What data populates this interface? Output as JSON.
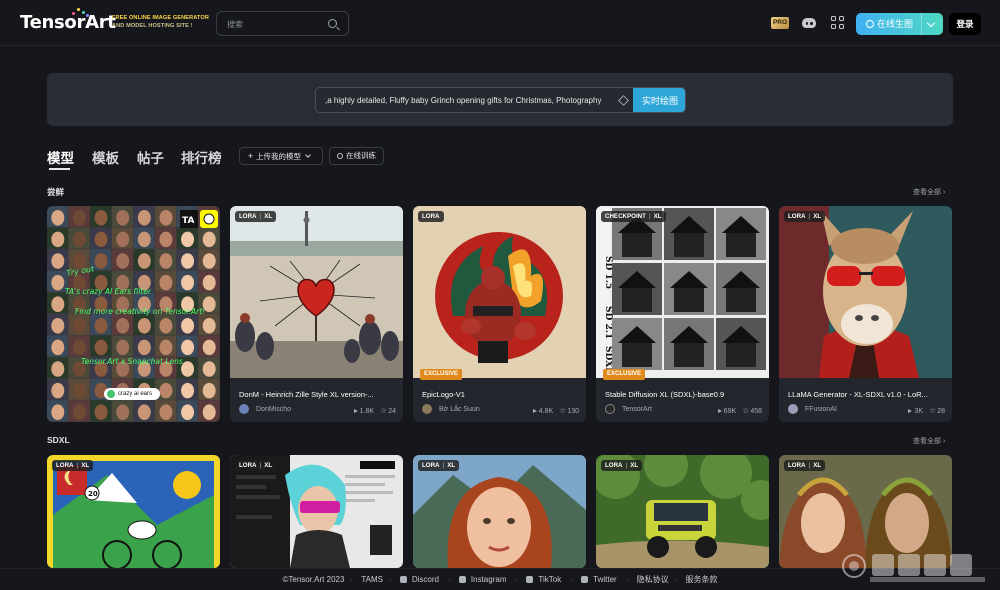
{
  "header": {
    "logo_text": "TensorArt",
    "tagline_line1": "FREE ONLINE IMAGE GENERATOR",
    "tagline_line2": "AND MODEL HOSTING SITE !",
    "search_placeholder": "搜索",
    "pro_label": "PRO",
    "create_button_label": "在线生图",
    "login_label": "登录"
  },
  "banner": {
    "prompt_text": ",a highly detailed, Fluffy baby Grinch opening gifts for Christmas, Photography",
    "generate_label": "实时绘图"
  },
  "nav": {
    "tabs": [
      "模型",
      "模板",
      "帖子",
      "排行榜"
    ],
    "upload_label": "上传我的模型",
    "train_label": "在线训练"
  },
  "sections": [
    {
      "title": "尝鲜",
      "see_all": "查看全部",
      "cards": [
        {
          "badges": [],
          "title": "",
          "author": "",
          "runs": "",
          "stars": "",
          "overlay_text": "crazy ai ears"
        },
        {
          "badges": [
            "LORA",
            "XL"
          ],
          "exclusive": false,
          "title": "DonM - Heinrich Zille Style XL version-...",
          "author": "DonMischo",
          "runs": "1.8K",
          "stars": "24"
        },
        {
          "badges": [
            "LORA"
          ],
          "exclusive": true,
          "exclusive_label": "EXCLUSIVE",
          "title": "EpicLogo-V1",
          "author": "Bờ Lắc Suun",
          "runs": "4.8K",
          "stars": "130"
        },
        {
          "badges": [
            "CHECKPOINT",
            "XL"
          ],
          "exclusive": true,
          "exclusive_label": "EXCLUSIVE",
          "title": "Stable Diffusion XL (SDXL)-base0.9",
          "author": "TensorArt",
          "runs": "69K",
          "stars": "458"
        },
        {
          "badges": [
            "LORA",
            "XL"
          ],
          "exclusive": false,
          "title": "LLaMA Generator - XL-SDXL v1.0 - LoR...",
          "author": "FFusionAI",
          "runs": "3K",
          "stars": "28"
        }
      ]
    },
    {
      "title": "SDXL",
      "see_all": "查看全部",
      "cards": [
        {
          "badges": [
            "LORA",
            "XL"
          ]
        },
        {
          "badges": [
            "LORA",
            "XL"
          ]
        },
        {
          "badges": [
            "LORA",
            "XL"
          ]
        },
        {
          "badges": [
            "LORA",
            "XL"
          ]
        },
        {
          "badges": [
            "LORA",
            "XL"
          ]
        }
      ]
    }
  ],
  "footer": {
    "copyright": "©Tensor.Art 2023",
    "links": [
      "TAMS",
      "Discord",
      "Instagram",
      "TikTok",
      "Twitter",
      "隐私协议",
      "服务条款"
    ]
  },
  "colors": {
    "background": "#15171c",
    "card": "#23262c",
    "accent_gradient_start": "#3fb1f0",
    "accent_gradient_end": "#4fd8c4",
    "exclusive": "#e08a1c"
  }
}
